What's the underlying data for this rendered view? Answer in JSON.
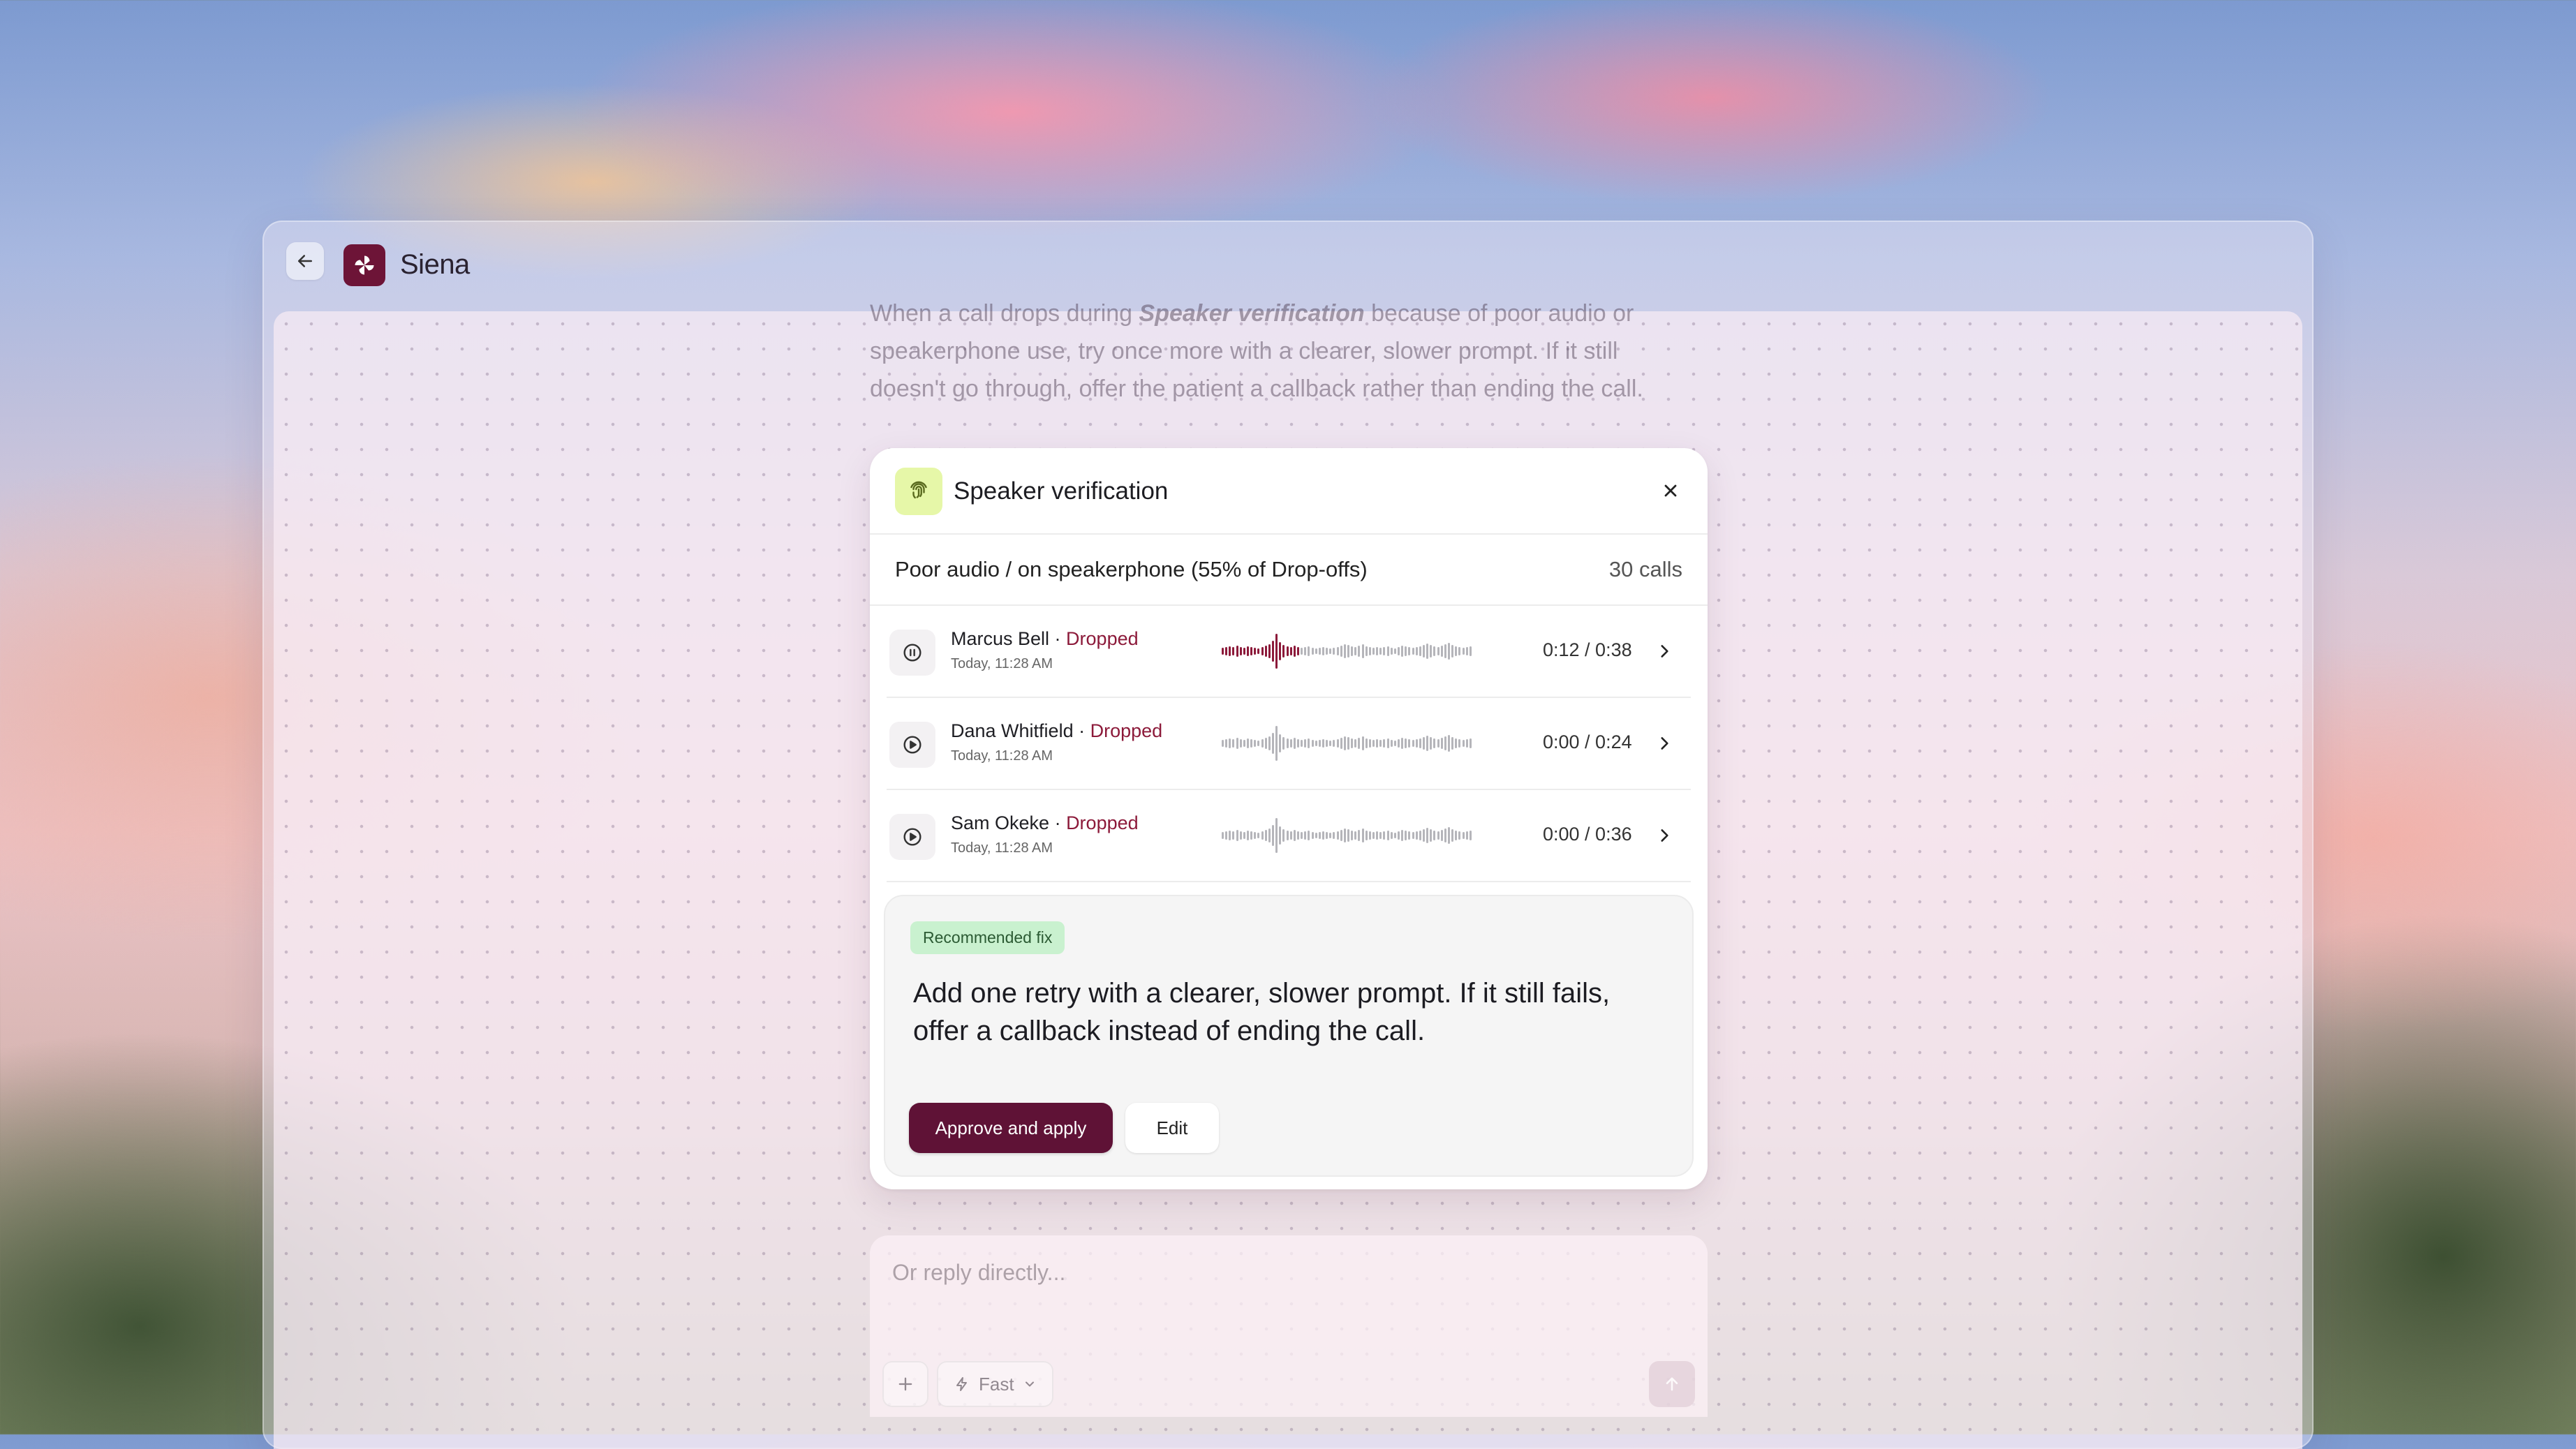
{
  "app": {
    "name": "Siena"
  },
  "context_text": {
    "before": "When a call drops during ",
    "emphasis": "Speaker verification",
    "after": " because of poor audio or speakerphone use, try once more with a clearer, slower prompt. If it still doesn't go through, offer the patient a callback rather than ending the call."
  },
  "card": {
    "title": "Speaker verification",
    "segment_label": "Poor audio / on speakerphone (55% of Drop-offs)",
    "segment_count": "30 calls",
    "calls": [
      {
        "name": "Marcus Bell",
        "separator": " · ",
        "status": "Dropped",
        "time": "Today, 11:28 AM",
        "duration": "0:12 / 0:38",
        "state": "playing",
        "progress": 0.32
      },
      {
        "name": "Dana Whitfield",
        "separator": " · ",
        "status": "Dropped",
        "time": "Today, 11:28 AM",
        "duration": "0:00 / 0:24",
        "state": "paused",
        "progress": 0
      },
      {
        "name": "Sam Okeke",
        "separator": " · ",
        "status": "Dropped",
        "time": "Today, 11:28 AM",
        "duration": "0:00 / 0:36",
        "state": "paused",
        "progress": 0
      }
    ],
    "fix": {
      "badge": "Recommended fix",
      "text": "Add one retry with a clearer, slower prompt. If it still fails, offer a callback instead of ending the call.",
      "approve_label": "Approve and apply",
      "edit_label": "Edit"
    }
  },
  "reply": {
    "placeholder": "Or reply directly...",
    "mode_label": "Fast"
  },
  "colors": {
    "brand": "#6d1437",
    "button": "#5f1236",
    "status_dropped": "#8c1a3a",
    "badge_bg": "#c9f1cf",
    "card_icon_bg": "#e6f7a8"
  },
  "icons": {
    "back": "arrow-left-icon",
    "logo": "pinwheel-logo-icon",
    "card": "fingerprint-icon",
    "close": "close-icon",
    "play": "play-icon",
    "pause": "pause-icon",
    "chevron": "chevron-right-icon",
    "plus": "plus-icon",
    "fast": "lightning-icon",
    "dropdown": "chevron-down-icon",
    "send": "arrow-up-icon"
  }
}
